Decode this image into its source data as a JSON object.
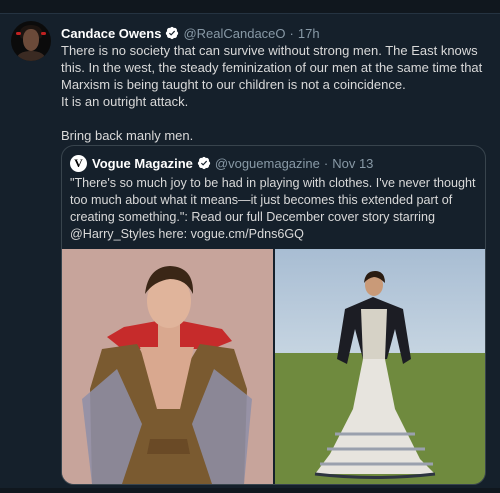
{
  "tweet": {
    "author_name": "Candace Owens",
    "handle": "@RealCandaceO",
    "separator": "·",
    "time": "17h",
    "lines": [
      "There is no society that can survive without strong men. The East knows this. In the west, the steady feminization of our men at the same time that Marxism is being taught to our children is not a coincidence.",
      "It is an outright attack.",
      "Bring back manly men."
    ]
  },
  "quoted": {
    "logo_letter": "V",
    "author_name": "Vogue Magazine",
    "handle": "@voguemagazine",
    "separator": "·",
    "date": "Nov 13",
    "text": "\"There's so much joy to be had in playing with clothes. I've never thought too much about what it means—it just becomes this extended part of creating something.\": Read our full December cover story starring @Harry_Styles here: vogue.cm/Pdns6GQ"
  },
  "colors": {
    "background": "#15202b",
    "verified": "#1da1f2",
    "secondary_text": "#8899a6",
    "border": "#38444d"
  },
  "icons": [
    "verified-badge-icon",
    "vogue-logo-icon"
  ]
}
